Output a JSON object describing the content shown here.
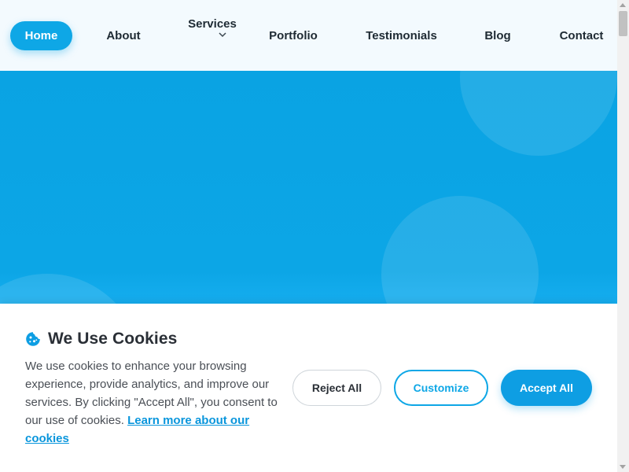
{
  "nav": {
    "home": "Home",
    "about": "About",
    "services": "Services",
    "portfolio": "Portfolio",
    "testimonials": "Testimonials",
    "blog": "Blog",
    "contact": "Contact"
  },
  "cookie": {
    "icon": "cookie-icon",
    "title": "We Use Cookies",
    "body": "We use cookies to enhance your browsing experience, provide analytics, and improve our services. By clicking \"Accept All\", you consent to our use of cookies.",
    "link": "Learn more about our cookies",
    "buttons": {
      "reject": "Reject All",
      "customize": "Customize",
      "accept": "Accept All"
    }
  },
  "colors": {
    "accent": "#0ea7e6",
    "hero": "#0aa3e3",
    "nav_bg": "#f3fafe"
  }
}
